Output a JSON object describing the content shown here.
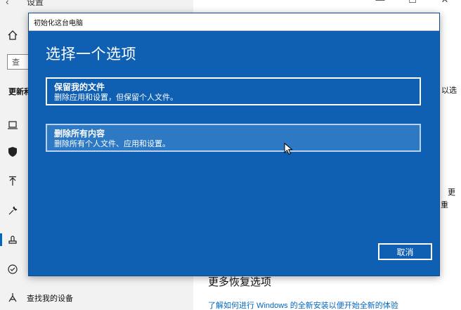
{
  "app": {
    "title": "设置",
    "back_glyph": "‹",
    "window_controls": [
      "—",
      "☐",
      "✕"
    ]
  },
  "sidebar": {
    "home_icon": "home-icon",
    "search_placeholder": "查",
    "section_title": "更新和",
    "find_device_label": "查找我的设备"
  },
  "main": {
    "snippet_right_top": "以选",
    "snippet_right_mid_1": "更",
    "snippet_right_mid_2": "重",
    "more_recovery_heading": "更多恢复选项",
    "fresh_start_link": "了解如何进行 Windows 的全新安装以便开始全新的体验"
  },
  "dialog": {
    "window_title": "初始化这台电脑",
    "heading": "选择一个选项",
    "options": [
      {
        "title": "保留我的文件",
        "description": "删除应用和设置，但保留个人文件。"
      },
      {
        "title": "删除所有内容",
        "description": "删除所有个人文件、应用和设置。"
      }
    ],
    "cancel_label": "取消"
  },
  "colors": {
    "dialog_blue": "#0f5fb3",
    "option_hover": "#2d79c4",
    "link_blue": "#0067c0"
  }
}
